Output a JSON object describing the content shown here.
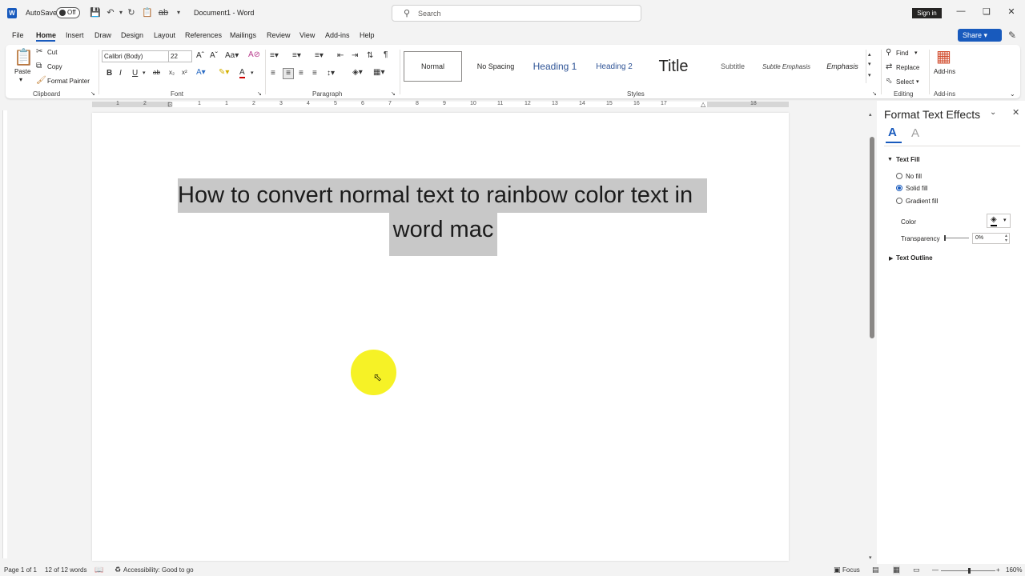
{
  "title_bar": {
    "autosave_label": "AutoSave",
    "autosave_state": "Off",
    "document_title": "Document1 - Word",
    "search_placeholder": "Search",
    "signin_label": "Sign in"
  },
  "tabs": [
    "File",
    "Home",
    "Insert",
    "Draw",
    "Design",
    "Layout",
    "References",
    "Mailings",
    "Review",
    "View",
    "Add-ins",
    "Help"
  ],
  "active_tab": "Home",
  "share_label": "Share",
  "ribbon": {
    "clipboard": {
      "paste": "Paste",
      "cut": "Cut",
      "copy": "Copy",
      "format_painter": "Format Painter",
      "group_label": "Clipboard"
    },
    "font": {
      "font_name": "Calibri (Body)",
      "font_size": "22",
      "group_label": "Font"
    },
    "paragraph": {
      "group_label": "Paragraph"
    },
    "styles": {
      "items": [
        "Normal",
        "No Spacing",
        "Heading 1",
        "Heading 2",
        "Title",
        "Subtitle",
        "Subtle Emphasis",
        "Emphasis"
      ],
      "group_label": "Styles"
    },
    "editing": {
      "find": "Find",
      "replace": "Replace",
      "select": "Select",
      "group_label": "Editing"
    },
    "addins": {
      "button": "Add-ins",
      "group_label": "Add-ins"
    }
  },
  "ruler_numbers": [
    "1",
    "2",
    "1",
    "1",
    "2",
    "3",
    "4",
    "5",
    "6",
    "7",
    "8",
    "9",
    "10",
    "11",
    "12",
    "13",
    "14",
    "15",
    "16",
    "17",
    "18"
  ],
  "document": {
    "line1": "How to convert normal text to rainbow color text in",
    "line2": "word mac"
  },
  "pane": {
    "title": "Format Text Effects",
    "section_fill": "Text Fill",
    "no_fill": "No fill",
    "solid_fill": "Solid fill",
    "gradient_fill": "Gradient fill",
    "color_label": "Color",
    "transparency_label": "Transparency",
    "transparency_value": "0%",
    "section_outline": "Text Outline"
  },
  "status": {
    "page": "Page 1 of 1",
    "words": "12 of 12 words",
    "accessibility": "Accessibility: Good to go",
    "focus": "Focus",
    "zoom": "160%"
  },
  "colors": {
    "accent": "#185abd",
    "selection": "#c8c8c8",
    "cursor_highlight": "#f5f000"
  }
}
